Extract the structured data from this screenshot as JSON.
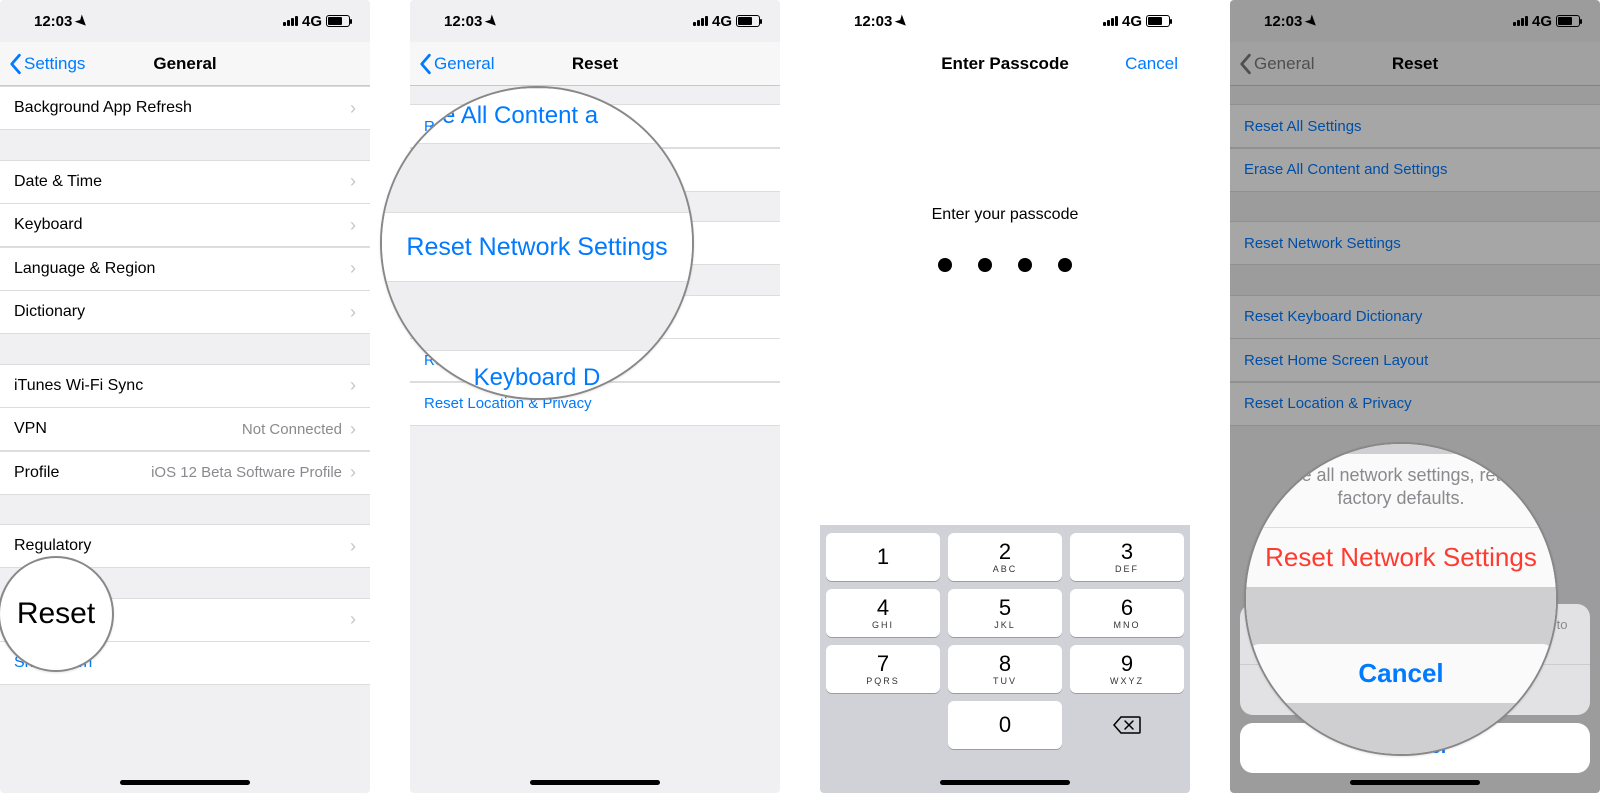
{
  "status": {
    "time": "12:03",
    "network": "4G"
  },
  "screen1": {
    "back": "Settings",
    "title": "General",
    "rows": {
      "bg_refresh": "Background App Refresh",
      "date_time": "Date & Time",
      "keyboard": "Keyboard",
      "language_region": "Language & Region",
      "dictionary": "Dictionary",
      "itunes_wifi": "iTunes Wi-Fi Sync",
      "vpn": "VPN",
      "vpn_value": "Not Connected",
      "profile": "Profile",
      "profile_value": "iOS 12 Beta Software Profile",
      "regulatory": "Regulatory",
      "reset": "Reset",
      "shutdown": "Shut Down"
    },
    "zoom": "Reset"
  },
  "screen2": {
    "back": "General",
    "title": "Reset",
    "rows": {
      "reset_all": "Reset All Settings",
      "erase_all": "Erase All Content and Settings",
      "reset_network": "Reset Network Settings",
      "reset_kb": "Reset Keyboard Dictionary",
      "reset_home": "Reset Home Screen Layout",
      "reset_loc": "Reset Location & Privacy"
    },
    "zoom": {
      "top_clip": "e All Content a",
      "main": "Reset Network Settings",
      "bottom_clip": "Keyboard D"
    }
  },
  "screen3": {
    "title": "Enter Passcode",
    "cancel": "Cancel",
    "prompt": "Enter your passcode",
    "keypad": [
      {
        "num": "1",
        "sub": ""
      },
      {
        "num": "2",
        "sub": "ABC"
      },
      {
        "num": "3",
        "sub": "DEF"
      },
      {
        "num": "4",
        "sub": "GHI"
      },
      {
        "num": "5",
        "sub": "JKL"
      },
      {
        "num": "6",
        "sub": "MNO"
      },
      {
        "num": "7",
        "sub": "PQRS"
      },
      {
        "num": "8",
        "sub": "TUV"
      },
      {
        "num": "9",
        "sub": "WXYZ"
      },
      {
        "num": "0",
        "sub": ""
      }
    ]
  },
  "screen4": {
    "back": "General",
    "title": "Reset",
    "rows": {
      "reset_all": "Reset All Settings",
      "erase_all": "Erase All Content and Settings",
      "reset_network": "Reset Network Settings",
      "reset_kb": "Reset Keyboard Dictionary",
      "reset_home": "Reset Home Screen Layout",
      "reset_loc": "Reset Location & Privacy"
    },
    "sheet": {
      "message": "This will delete all network settings, returning them to factory defaults.",
      "destructive": "Reset Network Settings",
      "cancel": "Cancel"
    },
    "zoom": {
      "message_clip": "e all network settings, ret\nfactory defaults.",
      "destructive": "Reset Network Settings",
      "cancel": "Cancel"
    }
  }
}
